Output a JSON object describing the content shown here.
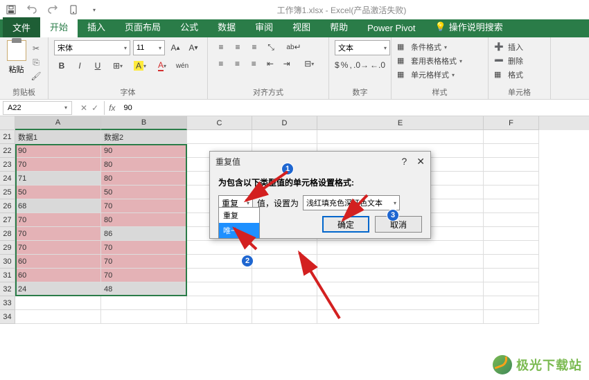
{
  "titlebar": {
    "title": "工作簿1.xlsx - Excel(产品激活失败)"
  },
  "tabs": {
    "file": "文件",
    "home": "开始",
    "insert": "插入",
    "layout": "页面布局",
    "formula": "公式",
    "data": "数据",
    "review": "审阅",
    "view": "视图",
    "help": "帮助",
    "pivot": "Power Pivot",
    "tellme": "操作说明搜索"
  },
  "ribbon": {
    "clipboard": {
      "paste": "粘贴",
      "label": "剪贴板"
    },
    "font": {
      "name": "宋体",
      "size": "11",
      "label": "字体"
    },
    "align": {
      "label": "对齐方式"
    },
    "number": {
      "format": "文本",
      "label": "数字"
    },
    "styles": {
      "cond": "条件格式",
      "table": "套用表格格式",
      "cell": "单元格样式",
      "label": "样式"
    },
    "cells": {
      "insert": "插入",
      "delete": "删除",
      "format": "格式",
      "label": "单元格"
    }
  },
  "namebox": "A22",
  "formula": "90",
  "cols": [
    "A",
    "B",
    "C",
    "D",
    "E",
    "F"
  ],
  "rows": [
    "21",
    "22",
    "23",
    "24",
    "25",
    "26",
    "27",
    "28",
    "29",
    "30",
    "31",
    "32",
    "33",
    "34"
  ],
  "headers": {
    "A": "数据1",
    "B": "数据2"
  },
  "dataA": [
    "90",
    "70",
    "71",
    "50",
    "68",
    "70",
    "70",
    "70",
    "60",
    "60",
    "24"
  ],
  "dataB": [
    "90",
    "80",
    "80",
    "50",
    "70",
    "80",
    "86",
    "70",
    "70",
    "70",
    "48"
  ],
  "dupA": [
    true,
    true,
    false,
    true,
    false,
    true,
    true,
    true,
    true,
    true,
    false
  ],
  "dupB": [
    true,
    true,
    true,
    true,
    true,
    true,
    false,
    true,
    true,
    true,
    false
  ],
  "dialog": {
    "title": "重复值",
    "label": "为包含以下类型值的单元格设置格式:",
    "type": "重复",
    "mid": "值，设置为",
    "format": "浅红填充色深红色文本",
    "opt1": "重复",
    "opt2": "唯一",
    "ok": "确定",
    "cancel": "取消"
  },
  "badges": {
    "b1": "1",
    "b2": "2",
    "b3": "3"
  },
  "watermark": "极光下载站"
}
